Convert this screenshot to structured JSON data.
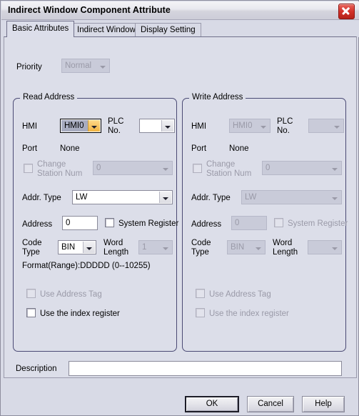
{
  "window": {
    "title": "Indirect Window Component Attribute",
    "close_icon": "close-icon"
  },
  "tabs": [
    {
      "label": "Basic Attributes",
      "active": true
    },
    {
      "label": "Indirect Window",
      "active": false
    },
    {
      "label": "Display Setting",
      "active": false
    }
  ],
  "priority": {
    "label": "Priority",
    "value": "Normal",
    "enabled": false
  },
  "read_address": {
    "title": "Read Address",
    "hmi_label": "HMI",
    "hmi_value": "HMI0",
    "plc_label": "PLC\nNo.",
    "plc_label_line1": "PLC",
    "plc_label_line2": "No.",
    "plc_value": "",
    "port_label": "Port",
    "port_value": "None",
    "change_station_label_line1": "Change",
    "change_station_label_line2": "Station Num",
    "change_station_checked": false,
    "station_value": "0",
    "addr_type_label": "Addr. Type",
    "addr_type_value": "LW",
    "address_label": "Address",
    "address_value": "0",
    "system_register_label": "System Register",
    "system_register_checked": false,
    "code_type_label_line1": "Code",
    "code_type_label_line2": "Type",
    "code_type_value": "BIN",
    "word_length_label_line1": "Word",
    "word_length_label_line2": "Length",
    "word_length_value": "1",
    "format_text": "Format(Range):DDDDD (0--10255)",
    "use_address_tag_label": "Use Address Tag",
    "use_address_tag_checked": false,
    "use_index_register_label": "Use the index register",
    "use_index_register_checked": false
  },
  "write_address": {
    "title": "Write Address",
    "hmi_label": "HMI",
    "hmi_value": "HMI0",
    "plc_label_line1": "PLC",
    "plc_label_line2": "No.",
    "plc_value": "",
    "port_label": "Port",
    "port_value": "None",
    "change_station_label_line1": "Change",
    "change_station_label_line2": "Station Num",
    "change_station_checked": false,
    "station_value": "0",
    "addr_type_label": "Addr. Type",
    "addr_type_value": "LW",
    "address_label": "Address",
    "address_value": "0",
    "system_register_label": "System Register",
    "system_register_checked": false,
    "code_type_label_line1": "Code",
    "code_type_label_line2": "Type",
    "code_type_value": "BIN",
    "word_length_label_line1": "Word",
    "word_length_label_line2": "Length",
    "word_length_value": "",
    "use_address_tag_label": "Use Address Tag",
    "use_address_tag_checked": false,
    "use_index_register_label": "Use the index register",
    "use_index_register_checked": false
  },
  "description": {
    "label": "Description",
    "value": "",
    "placeholder": ""
  },
  "buttons": {
    "ok": "OK",
    "cancel": "Cancel",
    "help": "Help"
  },
  "colors": {
    "dialog_bg": "#dcdee9",
    "group_border": "#4a4a74",
    "close_red": "#d2322a",
    "combo_focus_arrow": "#f2b441",
    "disabled_text": "#9a9aa8"
  }
}
